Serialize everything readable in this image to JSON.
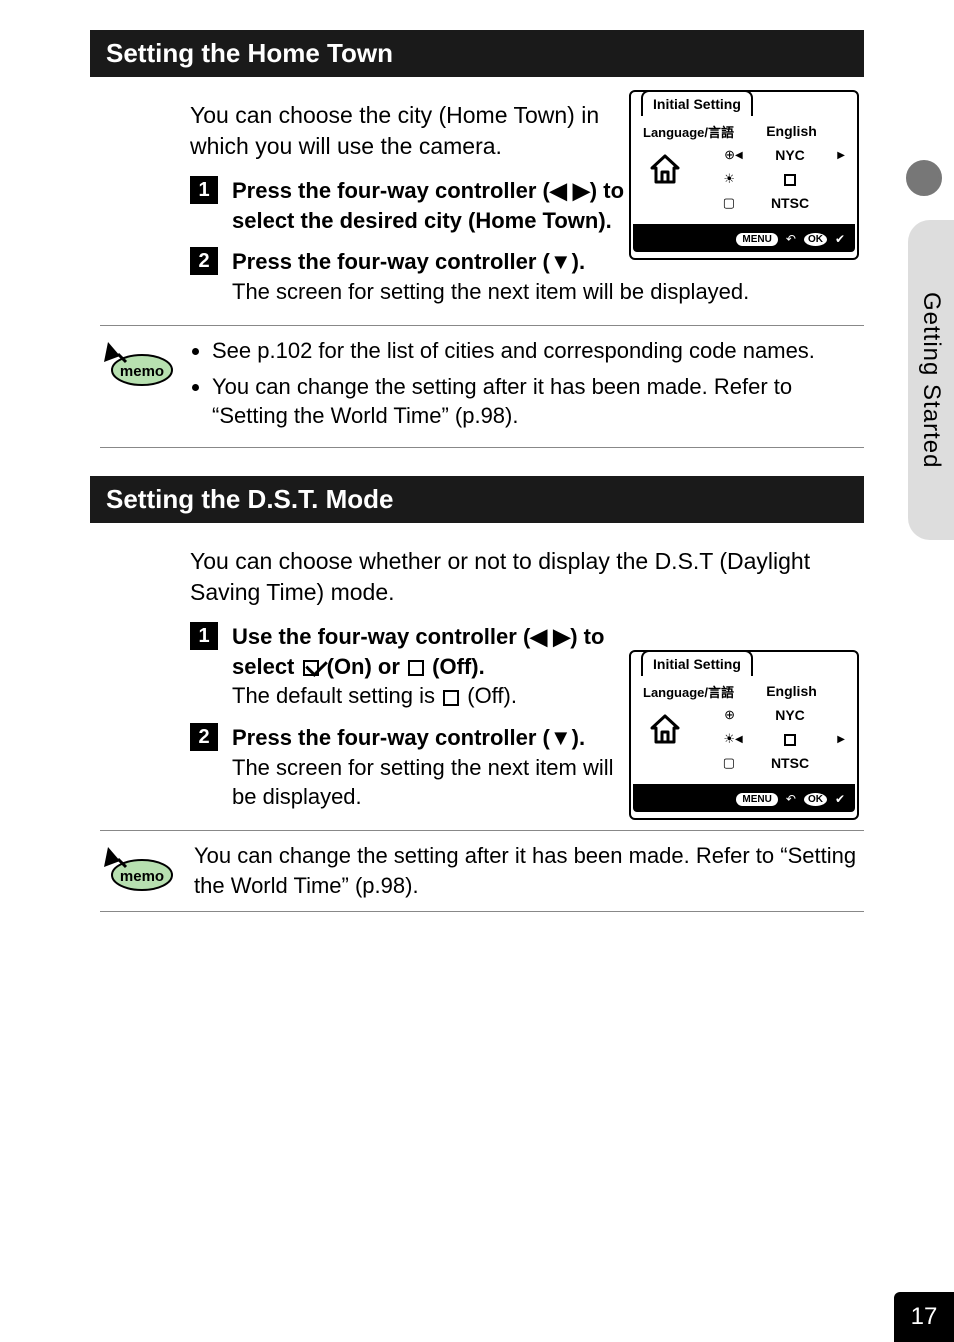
{
  "side_tab": "Getting Started",
  "page_number": "17",
  "section1": {
    "title": "Setting the Home Town",
    "intro": "You can choose the city (Home Town) in which you will use the camera.",
    "step1": "Press the four-way controller (◀ ▶) to select the desired city (Home Town).",
    "step2_bold": "Press the four-way controller (▼).",
    "step2_body": "The screen for setting the next item will be displayed.",
    "memo1": "See p.102 for the list of cities and corresponding code names.",
    "memo2": "You can change the setting after it has been made. Refer to “Setting the World Time” (p.98)."
  },
  "section2": {
    "title": "Setting the D.S.T. Mode",
    "intro": "You can choose whether or not to display the D.S.T (Daylight Saving Time) mode.",
    "step1_a": "Use the four-way controller (◀ ▶) to select ",
    "step1_b": " (On) or ",
    "step1_c": " (Off).",
    "step1_body_a": "The default setting is ",
    "step1_body_b": " (Off).",
    "step2_bold": "Press the four-way controller (▼).",
    "step2_body": "The screen for setting the next item will be displayed.",
    "memo": "You can change the setting after it has been made. Refer to “Setting the World Time” (p.98)."
  },
  "screen": {
    "tab": "Initial Setting",
    "lang_label": "Language/言語",
    "lang_value": "English",
    "city_value": "NYC",
    "video_value": "NTSC",
    "menu": "MENU",
    "ok": "OK"
  }
}
